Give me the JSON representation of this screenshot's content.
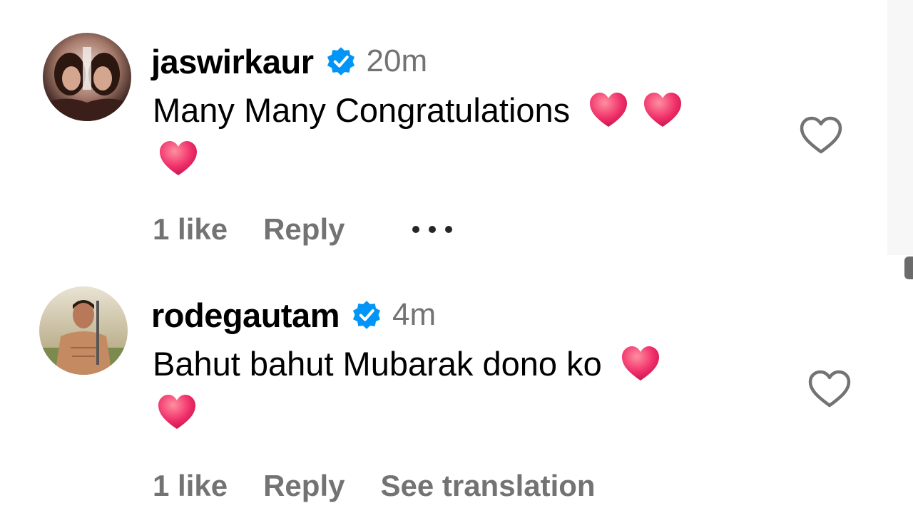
{
  "comments": [
    {
      "username": "jaswirkaur",
      "time": "20m",
      "text": "Many Many Congratulations",
      "likes": "1 like",
      "reply": "Reply",
      "avatar_icon": "avatar-jaswirkaur",
      "verified_icon": "verified-badge-icon"
    },
    {
      "username": "rodegautam",
      "time": "4m",
      "text": "Bahut bahut Mubarak dono ko",
      "likes": "1 like",
      "reply": "Reply",
      "translate": "See translation",
      "avatar_icon": "avatar-rodegautam",
      "verified_icon": "verified-badge-icon"
    }
  ],
  "colors": {
    "verified": "#0095f6",
    "meta_text": "#737373",
    "heart_emoji": "#f0306a"
  }
}
